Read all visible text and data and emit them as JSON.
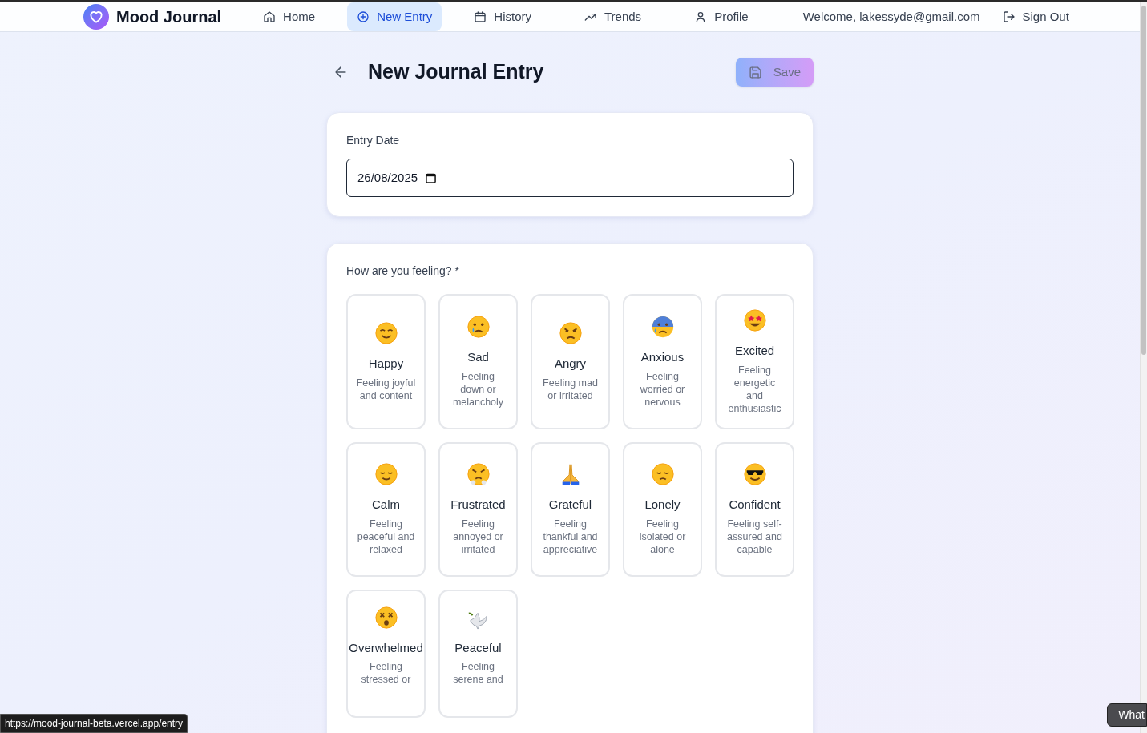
{
  "app": {
    "name": "Mood Journal"
  },
  "nav": [
    {
      "label": "Home",
      "selected": false
    },
    {
      "label": "New Entry",
      "selected": true
    },
    {
      "label": "History",
      "selected": false
    },
    {
      "label": "Trends",
      "selected": false
    },
    {
      "label": "Profile",
      "selected": false
    }
  ],
  "welcome": "Welcome, lakessyde@gmail.com",
  "sign_out": "Sign Out",
  "page_title": "New Journal Entry",
  "save": {
    "label": "Save",
    "disabled": true
  },
  "date": {
    "label": "Entry Date",
    "value": "26/08/2025"
  },
  "mood_prompt": "How are you feeling? *",
  "moods": [
    {
      "name": "Happy",
      "description": "Feeling joyful and content",
      "selected": false
    },
    {
      "name": "Sad",
      "description": "Feeling down or melancholy",
      "selected": false
    },
    {
      "name": "Angry",
      "description": "Feeling mad or irritated",
      "selected": false
    },
    {
      "name": "Anxious",
      "description": "Feeling worried or nervous",
      "selected": false
    },
    {
      "name": "Excited",
      "description": "Feeling energetic and enthusiastic",
      "selected": false
    },
    {
      "name": "Calm",
      "description": "Feeling peaceful and relaxed",
      "selected": false
    },
    {
      "name": "Frustrated",
      "description": "Feeling annoyed or irritated",
      "selected": false
    },
    {
      "name": "Grateful",
      "description": "Feeling thankful and appreciative",
      "selected": false
    },
    {
      "name": "Lonely",
      "description": "Feeling isolated or alone",
      "selected": false
    },
    {
      "name": "Confident",
      "description": "Feeling self-assured and capable",
      "selected": false
    },
    {
      "name": "Overwhelmed",
      "description": "Feeling stressed or",
      "selected": false
    },
    {
      "name": "Peaceful",
      "description": "Feeling serene and",
      "selected": false
    }
  ],
  "status_url": "https://mood-journal-beta.vercel.app/entry",
  "corner_bubble": "What"
}
